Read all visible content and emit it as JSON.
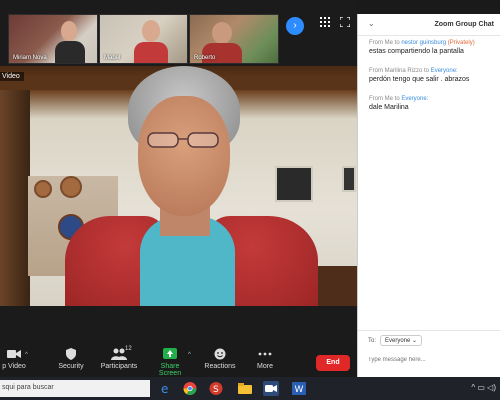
{
  "window": {
    "icons": {
      "grid": "grid-view-icon",
      "fullscreen": "fullscreen-icon"
    }
  },
  "thumbnails": [
    {
      "name": "Miriam Nova"
    },
    {
      "name": "Mabel"
    },
    {
      "name": "Roberto"
    }
  ],
  "main_video": {
    "label": "Video"
  },
  "toolbar": {
    "items": [
      {
        "label": "p Video",
        "icon": "camera-icon"
      },
      {
        "label": "Security",
        "icon": "shield-icon"
      },
      {
        "label": "Participants",
        "icon": "people-icon",
        "count": "12"
      },
      {
        "label": "Share Screen",
        "icon": "share-screen-icon"
      },
      {
        "label": "Reactions",
        "icon": "smile-icon"
      },
      {
        "label": "More",
        "icon": "more-icon"
      }
    ],
    "end_label": "End"
  },
  "chat": {
    "title": "Zoom Group Chat",
    "messages": [
      {
        "from": "From Me to",
        "to": "nestor guinsburg",
        "flag": "(Privately)",
        "text": "estas compartiendo la pantalla"
      },
      {
        "from": "From Marilina Rizzo to",
        "to": "Everyone:",
        "flag": "",
        "text": "perdón tengo que salir . abrazos"
      },
      {
        "from": "From Me to",
        "to": "Everyone:",
        "flag": "",
        "text": "dale Marilina"
      }
    ],
    "to_label": "To:",
    "to_value": "Everyone",
    "input_placeholder": "Type message here..."
  },
  "taskbar": {
    "search_text": "squi para buscar",
    "colors": {
      "accent": "#2d8cff",
      "end": "#e02828"
    }
  }
}
